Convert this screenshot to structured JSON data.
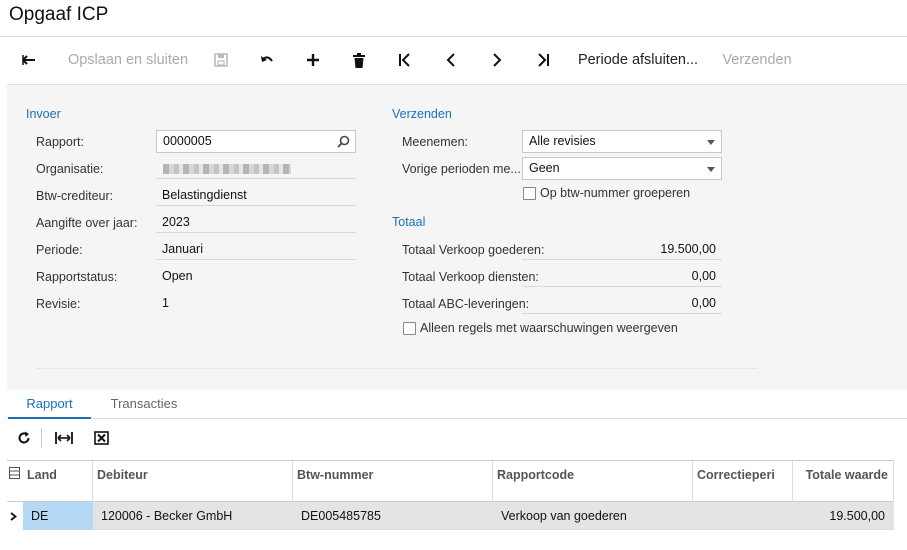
{
  "window": {
    "title": "Opgaaf ICP"
  },
  "toolbar": {
    "save_close": "Opslaan en sluiten",
    "close_period": "Periode afsluiten...",
    "send": "Verzenden"
  },
  "invoer": {
    "section_label": "Invoer",
    "fields": {
      "rapport": {
        "label": "Rapport:",
        "value": "0000005"
      },
      "organisatie": {
        "label": "Organisatie:"
      },
      "btw_crediteur": {
        "label": "Btw-crediteur:",
        "value": "Belastingdienst"
      },
      "aangifte_jaar": {
        "label": "Aangifte over jaar:",
        "value": "2023"
      },
      "periode": {
        "label": "Periode:",
        "value": "Januari"
      },
      "rapportstatus": {
        "label": "Rapportstatus:",
        "value": "Open"
      },
      "revisie": {
        "label": "Revisie:",
        "value": "1"
      }
    }
  },
  "verzenden": {
    "section_label": "Verzenden",
    "meenemen": {
      "label": "Meenemen:",
      "value": "Alle revisies"
    },
    "vorige_perioden": {
      "label": "Vorige perioden me...",
      "value": "Geen"
    },
    "group_checkbox": {
      "label": "Op btw-nummer groeperen",
      "checked": false
    }
  },
  "totaal": {
    "section_label": "Totaal",
    "verkoop_goederen": {
      "label": "Totaal Verkoop goederen:",
      "value": "19.500,00"
    },
    "verkoop_diensten": {
      "label": "Totaal Verkoop diensten:",
      "value": "0,00"
    },
    "abc_leveringen": {
      "label": "Totaal ABC-leveringen:",
      "value": "0,00"
    },
    "warnings_checkbox": {
      "label": "Alleen regels met waarschuwingen weergeven",
      "checked": false
    }
  },
  "tabs": [
    {
      "label": "Rapport",
      "active": true
    },
    {
      "label": "Transacties",
      "active": false
    }
  ],
  "grid": {
    "columns": [
      "Land",
      "Debiteur",
      "Btw-nummer",
      "Rapportcode",
      "Correctieperi",
      "Totale waarde"
    ],
    "rows": [
      {
        "land": "DE",
        "debiteur": "120006 - Becker GmbH",
        "btw": "DE005485785",
        "rapportcode": "Verkoop van goederen",
        "correctie": "",
        "totale_waarde": "19.500,00"
      }
    ]
  },
  "icons": [
    "back-icon",
    "save-icon",
    "undo-icon",
    "add-icon",
    "delete-icon",
    "first-icon",
    "prev-icon",
    "next-icon",
    "last-icon",
    "search-icon",
    "chevron-down-icon",
    "refresh-icon",
    "fit-columns-icon",
    "excel-icon",
    "column-config-icon",
    "row-expand-icon"
  ],
  "colors": {
    "accent": "#1b6fbd",
    "selected_cell": "#b5d9f5",
    "row_bg": "#e4e4e4"
  }
}
